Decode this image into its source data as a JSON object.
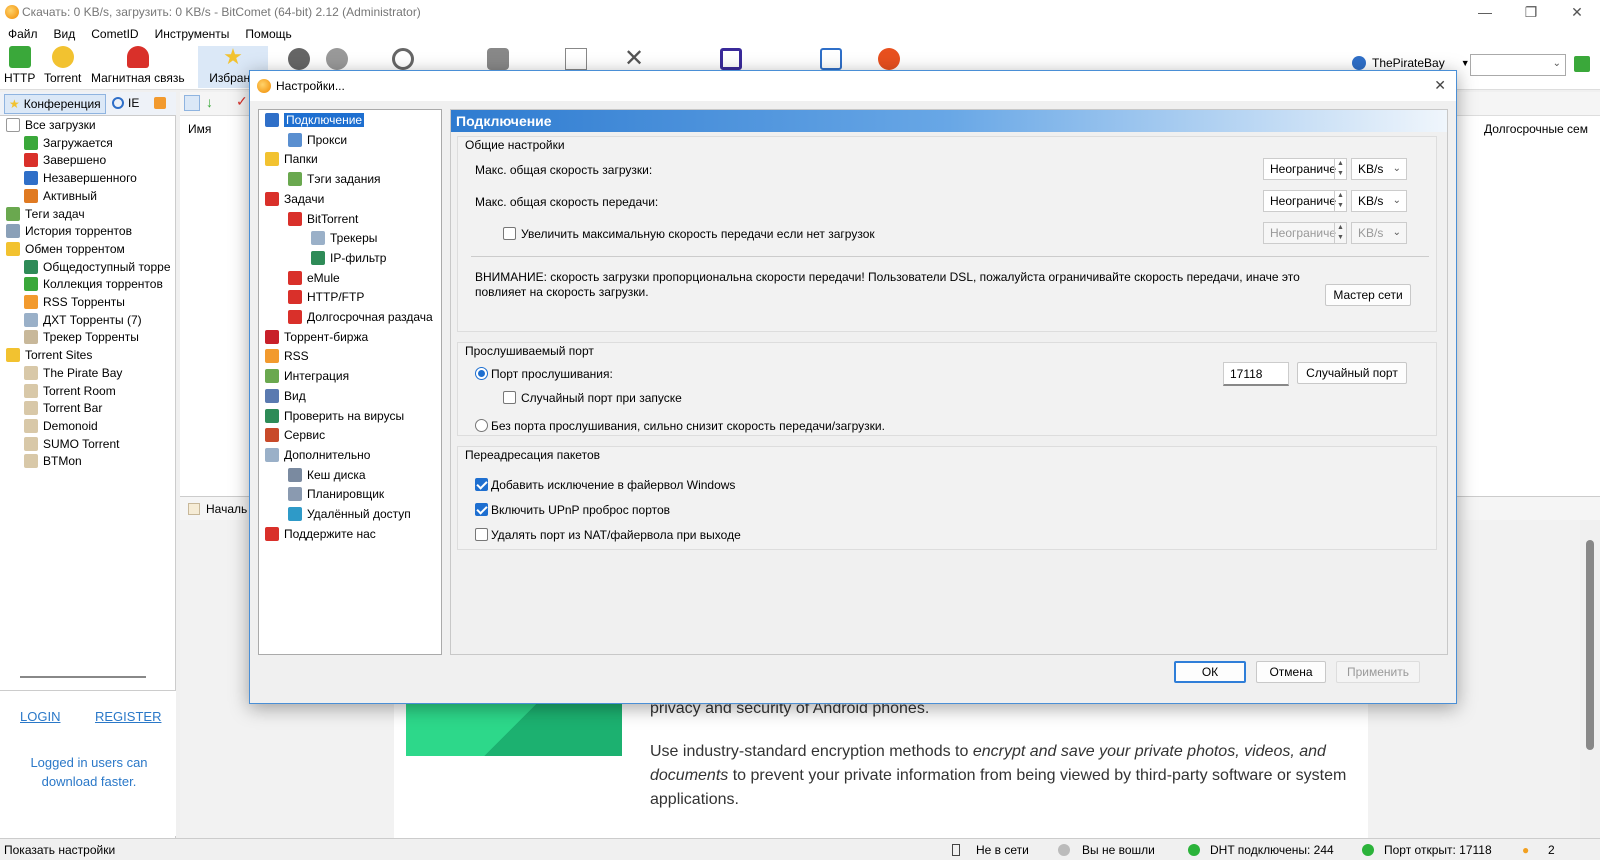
{
  "window": {
    "title": "Скачать: 0 KB/s, загрузить: 0 KB/s - BitComet (64-bit) 2.12 (Administrator)"
  },
  "menu": [
    "Файл",
    "Вид",
    "CometID",
    "Инструменты",
    "Помощь"
  ],
  "toolbar": {
    "http": "HTTP",
    "torrent": "Torrent",
    "magnet": "Магнитная связь",
    "favorites": "Избранн",
    "search_site": "ThePirateBay"
  },
  "sidebar": {
    "tabs": {
      "conference": "Конференция",
      "ie": "IE"
    },
    "items": [
      {
        "label": "Все загрузки",
        "level": 0,
        "color": "#ffffff"
      },
      {
        "label": "Загружается",
        "level": 1,
        "color": "#3aa83a"
      },
      {
        "label": "Завершено",
        "level": 1,
        "color": "#d9302a"
      },
      {
        "label": "Незавершенного",
        "level": 1,
        "color": "#2f6fc8"
      },
      {
        "label": "Активный",
        "level": 1,
        "color": "#e07a22"
      },
      {
        "label": "Теги задач",
        "level": 0,
        "color": "#6aa84f"
      },
      {
        "label": "История торрентов",
        "level": 0,
        "color": "#8aa0b8"
      },
      {
        "label": "Обмен торрентом",
        "level": 0,
        "color": "#f2c230"
      },
      {
        "label": "Общедоступный торре",
        "level": 1,
        "color": "#2e8b57"
      },
      {
        "label": "Коллекция торрентов",
        "level": 1,
        "color": "#3aa83a"
      },
      {
        "label": "RSS Торренты",
        "level": 1,
        "color": "#f29a2e"
      },
      {
        "label": "ДХТ Торренты (7)",
        "level": 1,
        "color": "#9ab0c8"
      },
      {
        "label": "Трекер Торренты",
        "level": 1,
        "color": "#c8b89a"
      },
      {
        "label": "Torrent Sites",
        "level": 0,
        "color": "#f2c230"
      },
      {
        "label": "The Pirate Bay",
        "level": 1,
        "color": "#d8c8a8"
      },
      {
        "label": "Torrent Room",
        "level": 1,
        "color": "#d8c8a8"
      },
      {
        "label": "Torrent Bar",
        "level": 1,
        "color": "#d8c8a8"
      },
      {
        "label": "Demonoid",
        "level": 1,
        "color": "#d8c8a8"
      },
      {
        "label": "SUMO Torrent",
        "level": 1,
        "color": "#d8c8a8"
      },
      {
        "label": "BTMon",
        "level": 1,
        "color": "#d8c8a8"
      }
    ],
    "login": "LOGIN",
    "register": "REGISTER",
    "login_hint": "Logged in users can download faster."
  },
  "main": {
    "col_name": "Имя",
    "col_longterm": "Долгосрочные сем",
    "bottom_tab": "Началь"
  },
  "article": {
    "line1": "privacy and security of Android phones.",
    "para_plain1": "Use industry-standard encryption methods to ",
    "para_italic1": "encrypt and save your private photos, videos, and documents",
    "para_plain2": " to prevent your private information from being viewed by third-party software or system applications."
  },
  "statusbar": {
    "left": "Показать настройки",
    "offline": "Не в сети",
    "not_logged": "Вы не вошли",
    "dht": "DHT подключены: 244",
    "port": "Порт открыт: 17118",
    "count": "2"
  },
  "dialog": {
    "title": "Настройки...",
    "nav": [
      {
        "label": "Подключение",
        "level": 0,
        "selected": true,
        "color": "#2f6fc8"
      },
      {
        "label": "Прокси",
        "level": 1,
        "color": "#5a8fd0"
      },
      {
        "label": "Папки",
        "level": 0,
        "color": "#f2c230"
      },
      {
        "label": "Тэги задания",
        "level": 1,
        "color": "#6aa84f"
      },
      {
        "label": "Задачи",
        "level": 0,
        "color": "#d9302a"
      },
      {
        "label": "BitTorrent",
        "level": 1,
        "color": "#d9302a"
      },
      {
        "label": "Трекеры",
        "level": 2,
        "color": "#9ab0c8"
      },
      {
        "label": "IP-фильтр",
        "level": 2,
        "color": "#2e8b57"
      },
      {
        "label": "eMule",
        "level": 1,
        "color": "#d9302a"
      },
      {
        "label": "HTTP/FTP",
        "level": 1,
        "color": "#d9302a"
      },
      {
        "label": "Долгосрочная раздача",
        "level": 1,
        "color": "#d9302a"
      },
      {
        "label": "Торрент-биржа",
        "level": 0,
        "color": "#c8202a"
      },
      {
        "label": "RSS",
        "level": 0,
        "color": "#f29a2e"
      },
      {
        "label": "Интеграция",
        "level": 0,
        "color": "#6aa84f"
      },
      {
        "label": "Вид",
        "level": 0,
        "color": "#5a7ab0"
      },
      {
        "label": "Проверить на вирусы",
        "level": 0,
        "color": "#2e8b57"
      },
      {
        "label": "Сервис",
        "level": 0,
        "color": "#c84a2a"
      },
      {
        "label": "Дополнительно",
        "level": 0,
        "color": "#9ab0c8"
      },
      {
        "label": "Кеш диска",
        "level": 1,
        "color": "#7a8aa0"
      },
      {
        "label": "Планировщик",
        "level": 1,
        "color": "#8a9ab0"
      },
      {
        "label": "Удалённый доступ",
        "level": 1,
        "color": "#2e9ac8"
      },
      {
        "label": "Поддержите нас",
        "level": 0,
        "color": "#d9302a"
      }
    ],
    "panel_title": "Подключение",
    "general": {
      "title": "Общие настройки",
      "max_download_label": "Макс. общая скорость загрузки:",
      "max_download_value": "Неограниче",
      "max_download_unit": "KB/s",
      "max_upload_label": "Макс. общая скорость передачи:",
      "max_upload_value": "Неограниче",
      "max_upload_unit": "KB/s",
      "boost_label": "Увеличить максимальную скорость передачи если нет загрузок",
      "boost_checked": false,
      "boost_value": "Неограниче",
      "boost_unit": "KB/s",
      "warning": "ВНИМАНИЕ: скорость загрузки пропорциональна скорости передачи! Пользователи DSL, пожалуйста ограничивайте скорость передачи, иначе это повлияет на скорость загрузки.",
      "wizard_button": "Мастер сети"
    },
    "port": {
      "title": "Прослушиваемый порт",
      "listen_label": "Порт прослушивания:",
      "listen_value": "17118",
      "random_button": "Случайный порт",
      "random_on_start": "Случайный порт при запуске",
      "no_port": "Без порта прослушивания, сильно снизит скорость передачи/загрузки."
    },
    "forwarding": {
      "title": "Переадресация пакетов",
      "firewall": "Добавить исключение в файервол Windows",
      "upnp": "Включить UPnP проброс портов",
      "remove_nat": "Удалять порт из NAT/файервола при выходе"
    },
    "buttons": {
      "ok": "ОК",
      "cancel": "Отмена",
      "apply": "Применить"
    }
  }
}
